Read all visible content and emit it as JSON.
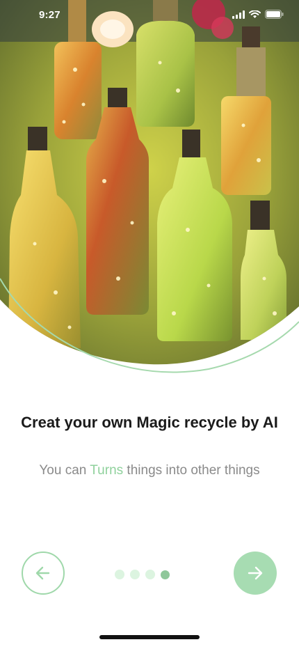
{
  "status_bar": {
    "time": "9:27",
    "icons": [
      "signal-icon",
      "wifi-icon",
      "battery-icon"
    ]
  },
  "hero": {
    "image": "decorated-glass-bottle-lights-photo"
  },
  "onboarding": {
    "title": "Creat your own Magic recycle by AI",
    "subtitle_before": "You can ",
    "subtitle_accent": "Turns",
    "subtitle_after": " things into other things"
  },
  "pagination": {
    "total": 4,
    "active_index": 4
  },
  "navigation": {
    "prev_icon": "arrow-left-icon",
    "next_icon": "arrow-right-icon"
  },
  "colors": {
    "accent": "#8fd19c",
    "next_button": "#a7dcb2",
    "prev_border": "#9fd8aa",
    "dot_inactive": "#dcf4e0",
    "dot_active": "#8fc79a"
  }
}
